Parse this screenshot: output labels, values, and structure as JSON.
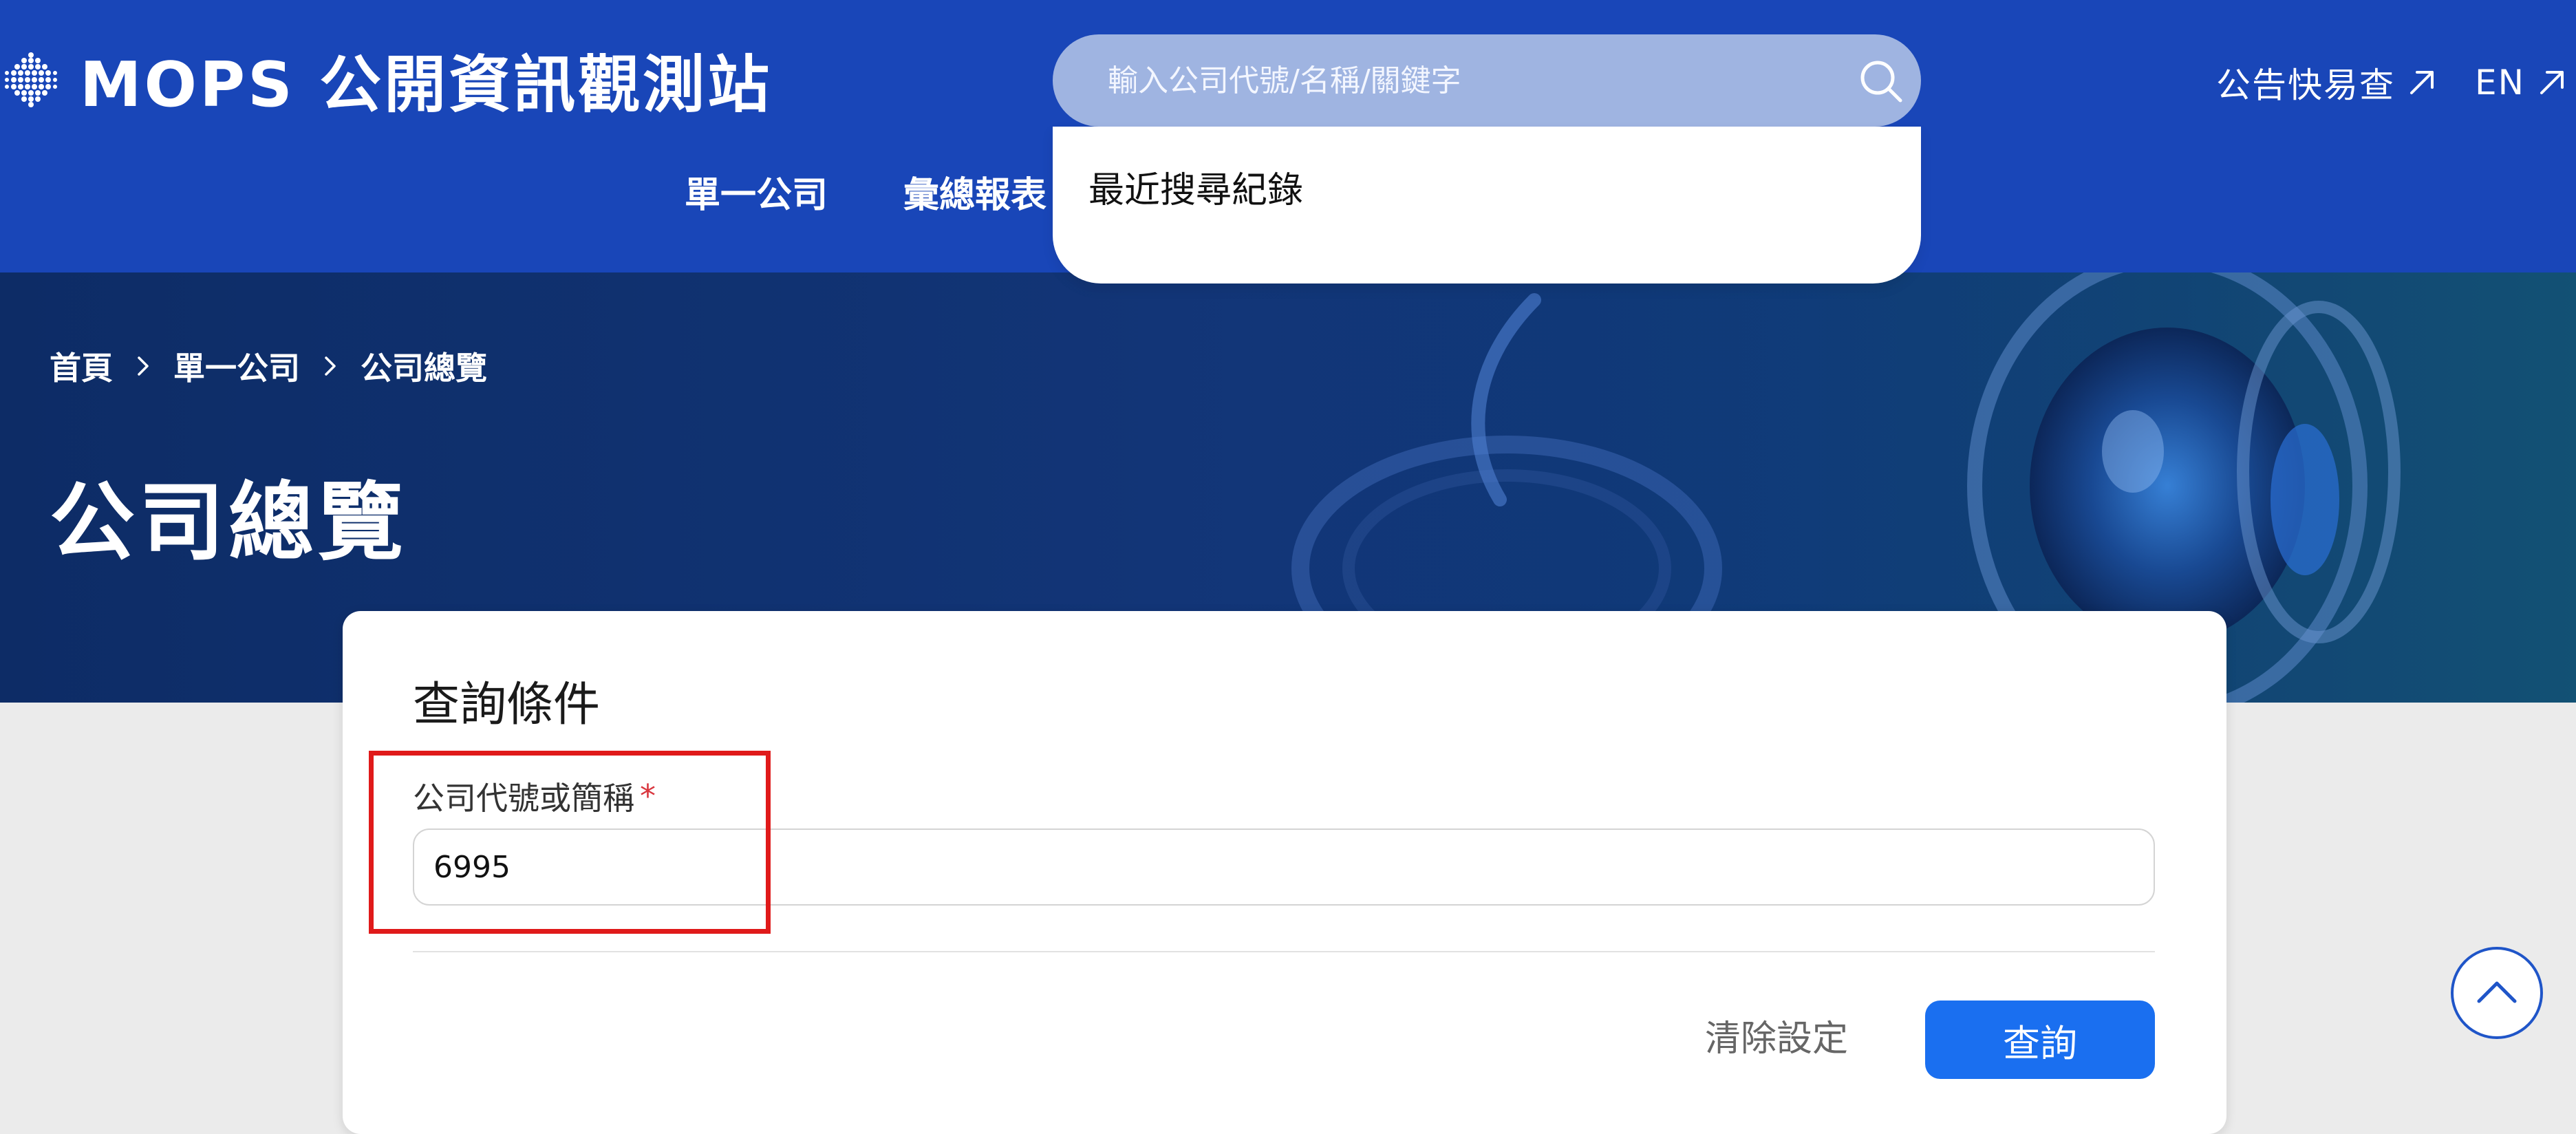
{
  "header": {
    "logo_text": "MOPS 公開資訊觀測站",
    "search": {
      "placeholder": "輸入公司代號/名稱/關鍵字",
      "value": ""
    },
    "quick_links": [
      {
        "label": "公告快易查",
        "icon": "external-link-icon"
      },
      {
        "label": "EN",
        "icon": "external-link-icon"
      }
    ],
    "nav": [
      {
        "label": "單一公司"
      },
      {
        "label": "彙總報表"
      }
    ]
  },
  "search_dropdown": {
    "title": "最近搜尋紀錄"
  },
  "hero": {
    "breadcrumb": [
      "首頁",
      "單一公司",
      "公司總覽"
    ],
    "title": "公司總覽"
  },
  "query_card": {
    "title": "查詢條件",
    "field": {
      "label": "公司代號或簡稱",
      "required_mark": "*",
      "value": "6995"
    },
    "clear_label": "清除設定",
    "submit_label": "查詢"
  },
  "colors": {
    "header_bg": "#1946b8",
    "hero_bg": "#0d2c66",
    "primary_button": "#1a6ff0",
    "required": "#d9363e",
    "highlight": "#e01a1a",
    "page_bg": "#ebebeb"
  },
  "icons": [
    "logo-dots-icon",
    "search-icon",
    "external-link-icon",
    "chevron-right-icon",
    "chevron-up-icon"
  ]
}
